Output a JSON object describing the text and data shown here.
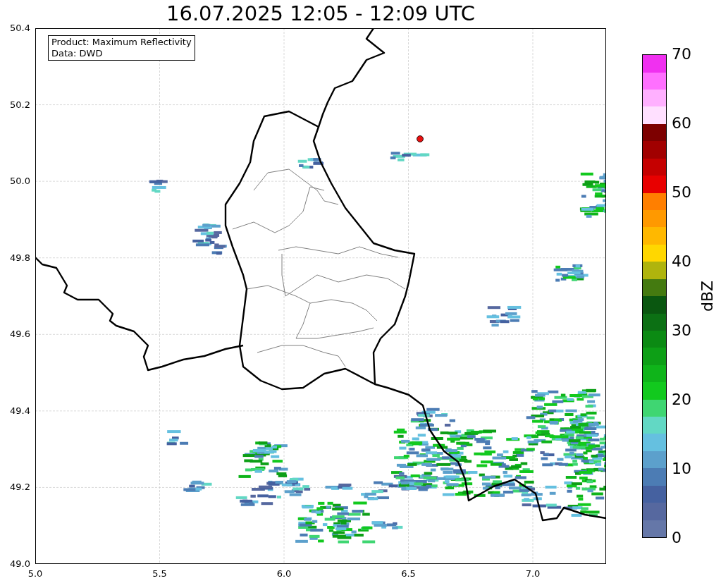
{
  "title": "16.07.2025 12:05 - 12:09 UTC",
  "legend": [
    "Product: Maximum Reflectivity",
    "Data: DWD"
  ],
  "y_axis": {
    "ticks": [
      "50.4",
      "50.2",
      "50.0",
      "49.8",
      "49.6",
      "49.4",
      "49.2",
      "49.0"
    ]
  },
  "x_axis": {
    "ticks": [
      "5.0",
      "5.5",
      "6.0",
      "6.5",
      "7.0"
    ]
  },
  "colorbar": {
    "label": "dBZ",
    "ticks": [
      "70",
      "60",
      "50",
      "40",
      "30",
      "20",
      "10",
      "0"
    ],
    "bins": [
      {
        "color": "#6577a8"
      },
      {
        "color": "#56689f"
      },
      {
        "color": "#4561a0"
      },
      {
        "color": "#4c7cb4"
      },
      {
        "color": "#5ca0cc"
      },
      {
        "color": "#65c0e0"
      },
      {
        "color": "#62d8c4"
      },
      {
        "color": "#3fd672"
      },
      {
        "color": "#12c91e"
      },
      {
        "color": "#0fb41a"
      },
      {
        "color": "#0d9f16"
      },
      {
        "color": "#0b8a13"
      },
      {
        "color": "#0c7014"
      },
      {
        "color": "#0a5710"
      },
      {
        "color": "#447a10"
      },
      {
        "color": "#afb40d"
      },
      {
        "color": "#ffd700"
      },
      {
        "color": "#ffb800"
      },
      {
        "color": "#ff9900"
      },
      {
        "color": "#ff7f00"
      },
      {
        "color": "#e80000"
      },
      {
        "color": "#c50000"
      },
      {
        "color": "#a10000"
      },
      {
        "color": "#7d0000"
      },
      {
        "color": "#ffe0ff"
      },
      {
        "color": "#ffb0ff"
      },
      {
        "color": "#ff70ff"
      },
      {
        "color": "#f030f0"
      }
    ]
  }
}
